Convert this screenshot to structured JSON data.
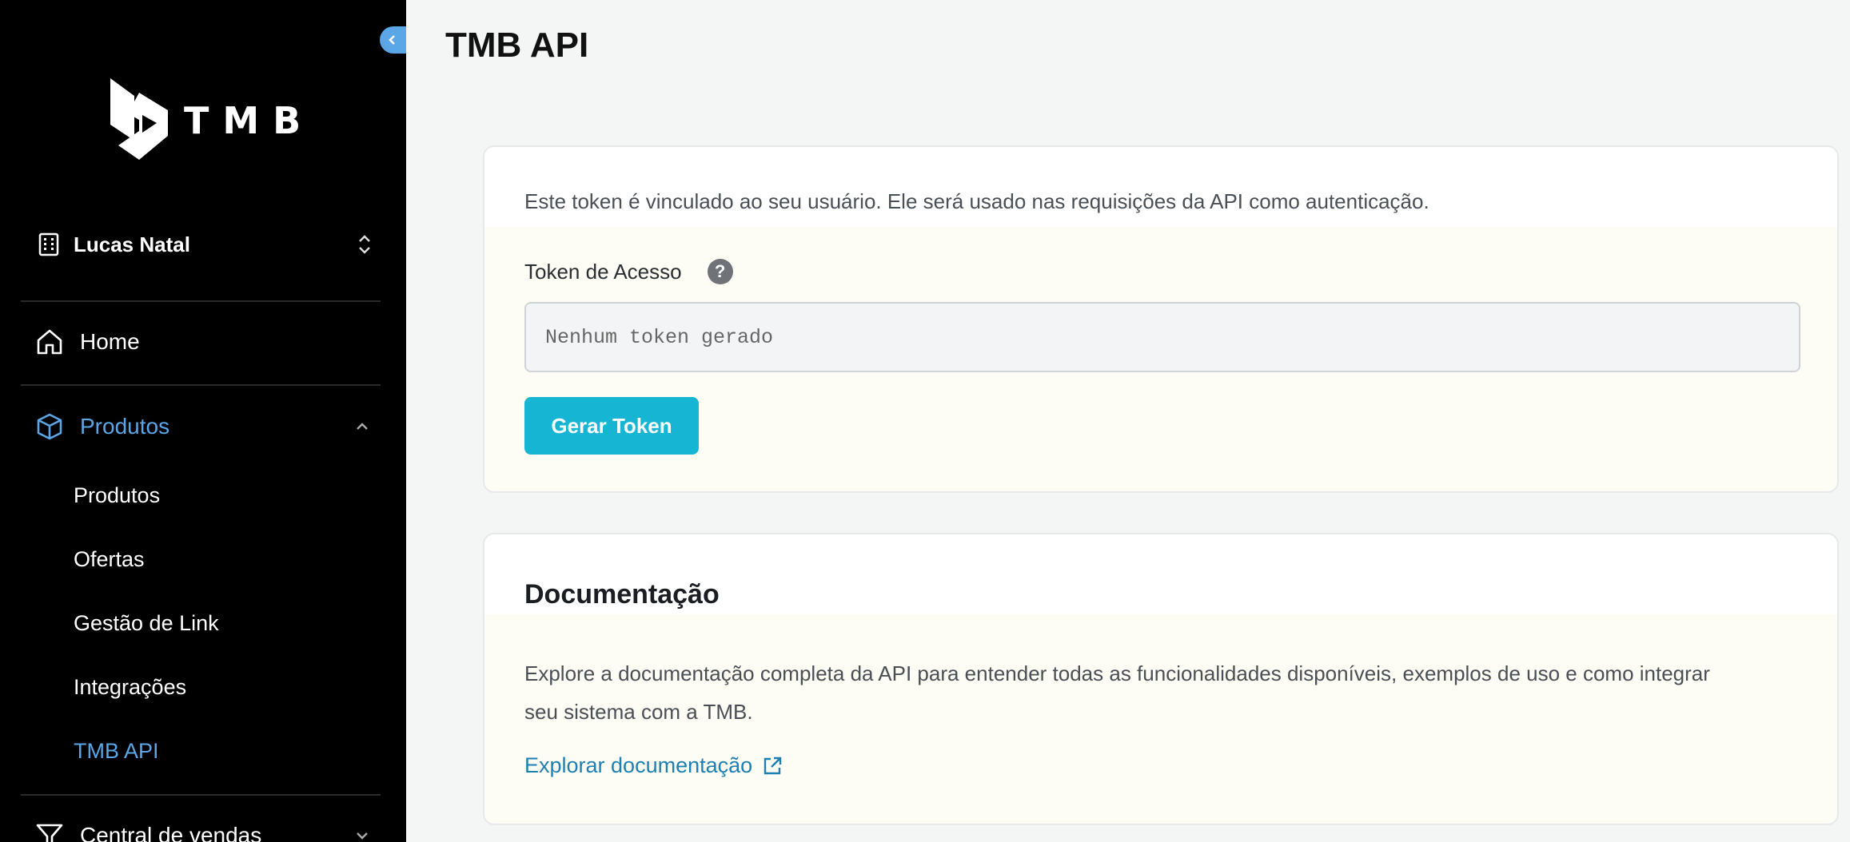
{
  "sidebar": {
    "logo_text": "TMB",
    "org_name": "Lucas Natal",
    "nav": {
      "home": "Home",
      "produtos": "Produtos",
      "central": "Central de vendas"
    },
    "sub_items": [
      "Produtos",
      "Ofertas",
      "Gestão de Link",
      "Integrações",
      "TMB API"
    ]
  },
  "main": {
    "title": "TMB API",
    "token_card": {
      "description": "Este token é vinculado ao seu usuário. Ele será usado nas requisições da API como autenticação.",
      "label": "Token de Acesso",
      "help_glyph": "?",
      "input_placeholder": "Nenhum token gerado",
      "button": "Gerar Token"
    },
    "doc_card": {
      "title": "Documentação",
      "description_line1": "Explore a documentação completa da API para entender todas as funcionalidades disponíveis, exemplos de uso e como integrar",
      "description_line2": "seu sistema com a TMB.",
      "link": "Explorar documentação"
    }
  },
  "colors": {
    "accent": "#5aa6e6",
    "button": "#16b5d4",
    "link": "#1e7fb2"
  }
}
